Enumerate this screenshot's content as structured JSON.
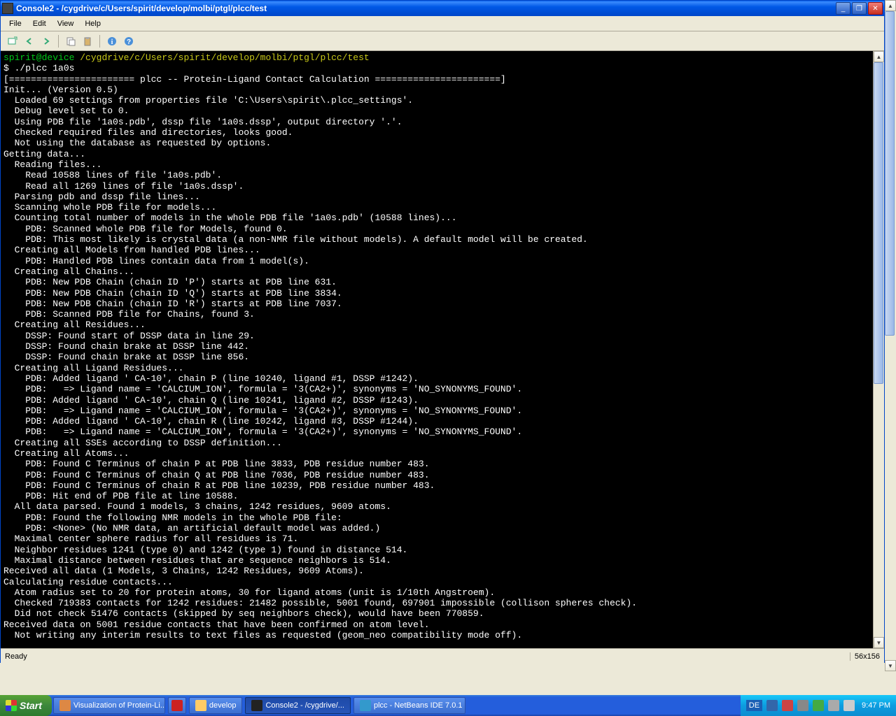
{
  "window": {
    "title": "Console2 - /cygdrive/c/Users/spirit/develop/molbi/ptgl/plcc/test"
  },
  "menu": {
    "file": "File",
    "edit": "Edit",
    "view": "View",
    "help": "Help"
  },
  "terminal": {
    "prompt_user": "spirit@device",
    "prompt_path": "/cygdrive/c/Users/spirit/develop/molbi/ptgl/plcc/test",
    "command": "$ ./plcc 1a0s",
    "lines": [
      "[======================= plcc -- Protein-Ligand Contact Calculation =======================]",
      "Init... (Version 0.5)",
      "  Loaded 69 settings from properties file 'C:\\Users\\spirit\\.plcc_settings'.",
      "  Debug level set to 0.",
      "  Using PDB file '1a0s.pdb', dssp file '1a0s.dssp', output directory '.'.",
      "  Checked required files and directories, looks good.",
      "  Not using the database as requested by options.",
      "Getting data...",
      "  Reading files...",
      "    Read 10588 lines of file '1a0s.pdb'.",
      "    Read all 1269 lines of file '1a0s.dssp'.",
      "  Parsing pdb and dssp file lines...",
      "  Scanning whole PDB file for models...",
      "  Counting total number of models in the whole PDB file '1a0s.pdb' (10588 lines)...",
      "    PDB: Scanned whole PDB file for Models, found 0.",
      "    PDB: This most likely is crystal data (a non-NMR file without models). A default model will be created.",
      "  Creating all Models from handled PDB lines...",
      "    PDB: Handled PDB lines contain data from 1 model(s).",
      "  Creating all Chains...",
      "    PDB: New PDB Chain (chain ID 'P') starts at PDB line 631.",
      "    PDB: New PDB Chain (chain ID 'Q') starts at PDB line 3834.",
      "    PDB: New PDB Chain (chain ID 'R') starts at PDB line 7037.",
      "    PDB: Scanned PDB file for Chains, found 3.",
      "  Creating all Residues...",
      "    DSSP: Found start of DSSP data in line 29.",
      "    DSSP: Found chain brake at DSSP line 442.",
      "    DSSP: Found chain brake at DSSP line 856.",
      "  Creating all Ligand Residues...",
      "    PDB: Added ligand ' CA-10', chain P (line 10240, ligand #1, DSSP #1242).",
      "    PDB:   => Ligand name = 'CALCIUM_ION', formula = '3(CA2+)', synonyms = 'NO_SYNONYMS_FOUND'.",
      "    PDB: Added ligand ' CA-10', chain Q (line 10241, ligand #2, DSSP #1243).",
      "    PDB:   => Ligand name = 'CALCIUM_ION', formula = '3(CA2+)', synonyms = 'NO_SYNONYMS_FOUND'.",
      "    PDB: Added ligand ' CA-10', chain R (line 10242, ligand #3, DSSP #1244).",
      "    PDB:   => Ligand name = 'CALCIUM_ION', formula = '3(CA2+)', synonyms = 'NO_SYNONYMS_FOUND'.",
      "  Creating all SSEs according to DSSP definition...",
      "  Creating all Atoms...",
      "    PDB: Found C Terminus of chain P at PDB line 3833, PDB residue number 483.",
      "    PDB: Found C Terminus of chain Q at PDB line 7036, PDB residue number 483.",
      "    PDB: Found C Terminus of chain R at PDB line 10239, PDB residue number 483.",
      "    PDB: Hit end of PDB file at line 10588.",
      "  All data parsed. Found 1 models, 3 chains, 1242 residues, 9609 atoms.",
      "    PDB: Found the following NMR models in the whole PDB file:",
      "    PDB: <None> (No NMR data, an artificial default model was added.)",
      "  Maximal center sphere radius for all residues is 71.",
      "  Neighbor residues 1241 (type 0) and 1242 (type 1) found in distance 514.",
      "  Maximal distance between residues that are sequence neighbors is 514.",
      "Received all data (1 Models, 3 Chains, 1242 Residues, 9609 Atoms).",
      "Calculating residue contacts...",
      "  Atom radius set to 20 for protein atoms, 30 for ligand atoms (unit is 1/10th Angstroem).",
      "  Checked 719383 contacts for 1242 residues: 21482 possible, 5001 found, 697901 impossible (collison spheres check).",
      "  Did not check 51476 contacts (skipped by seq neighbors check), would have been 770859.",
      "Received data on 5001 residue contacts that have been confirmed on atom level.",
      "  Not writing any interim results to text files as requested (geom_neo compatibility mode off)."
    ]
  },
  "status": {
    "left": "Ready",
    "right": "56x156"
  },
  "taskbar": {
    "start": "Start",
    "btn1": "Visualization of Protein-Li...",
    "btn2": "develop",
    "btn3": "Console2 - /cygdrive/...",
    "btn4": "plcc - NetBeans IDE 7.0.1",
    "lang": "DE",
    "clock": "9:47 PM"
  }
}
